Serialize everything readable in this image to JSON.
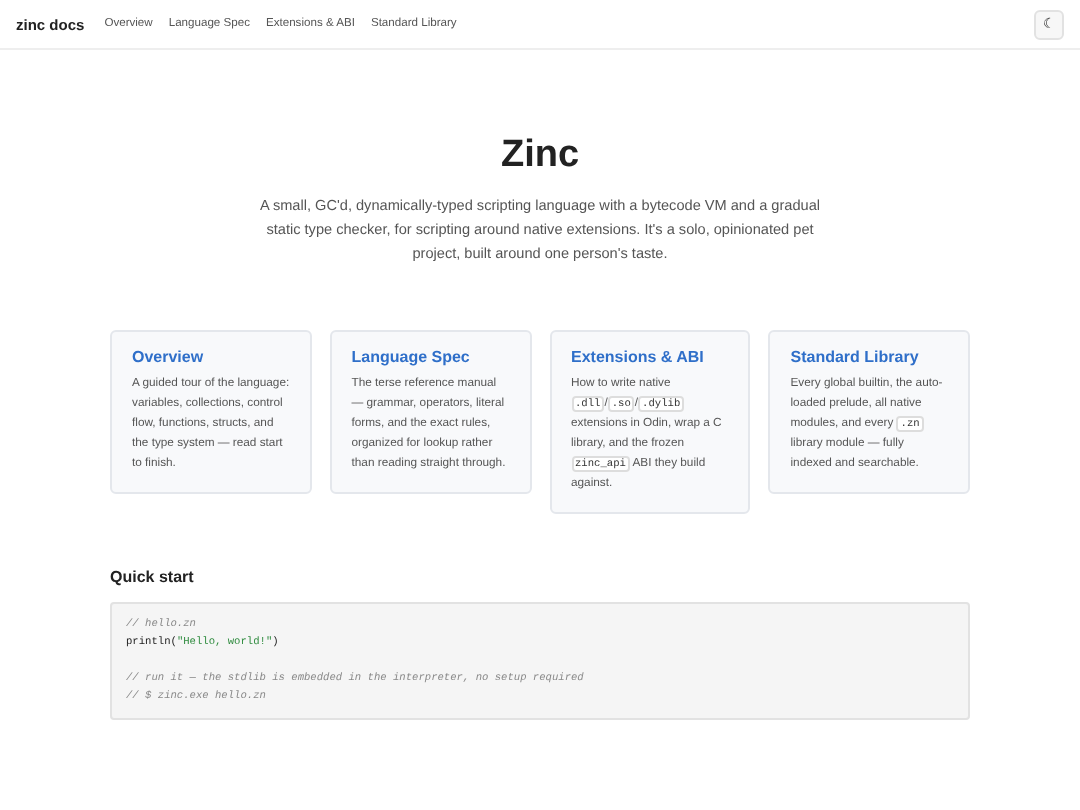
{
  "nav": {
    "brand": "zinc docs",
    "links": [
      "Overview",
      "Language Spec",
      "Extensions & ABI",
      "Standard Library"
    ],
    "theme_toggle": "☾"
  },
  "hero": {
    "title": "Zinc",
    "description": "A small, GC'd, dynamically-typed scripting language with a bytecode VM and a gradual static type checker, for scripting around native extensions. It's a solo, opinionated pet project, built around one person's taste."
  },
  "cards": [
    {
      "title": "Overview",
      "description": [
        {
          "kind": "text",
          "text": "A guided tour of the language: variables, collections, control flow, functions, structs, and the type system — read start to finish."
        }
      ]
    },
    {
      "title": "Language Spec",
      "description": [
        {
          "kind": "text",
          "text": "The terse reference manual — grammar, operators, literal forms, and the exact rules, organized for lookup rather than reading straight through."
        }
      ]
    },
    {
      "title": "Extensions & ABI",
      "description": [
        {
          "kind": "text",
          "text": "How to write native "
        },
        {
          "kind": "code",
          "text": ".dll"
        },
        {
          "kind": "text",
          "text": "/"
        },
        {
          "kind": "code",
          "text": ".so"
        },
        {
          "kind": "text",
          "text": "/"
        },
        {
          "kind": "code",
          "text": ".dylib"
        },
        {
          "kind": "text",
          "text": " extensions in Odin, wrap a C library, and the frozen "
        },
        {
          "kind": "code",
          "text": "zinc_api"
        },
        {
          "kind": "text",
          "text": " ABI they build against."
        }
      ]
    },
    {
      "title": "Standard Library",
      "description": [
        {
          "kind": "text",
          "text": "Every global builtin, the auto-loaded prelude, all native modules, and every "
        },
        {
          "kind": "code",
          "text": ".zn"
        },
        {
          "kind": "text",
          "text": " library module — fully indexed and searchable."
        }
      ]
    }
  ],
  "quick_start": {
    "heading": "Quick start",
    "code_paragraphs": [
      {
        "lines": [
          [
            {
              "kind": "comment",
              "text": "// hello.zn"
            }
          ],
          [
            {
              "kind": "plain",
              "text": "println("
            },
            {
              "kind": "string",
              "text": "\"Hello, world!\""
            },
            {
              "kind": "plain",
              "text": ")"
            }
          ]
        ]
      },
      {
        "lines": [
          [
            {
              "kind": "comment",
              "text": "// run it — the stdlib is embedded in the interpreter, no setup required"
            }
          ],
          [
            {
              "kind": "comment",
              "text": "// $ zinc.exe hello.zn"
            }
          ]
        ]
      }
    ]
  }
}
